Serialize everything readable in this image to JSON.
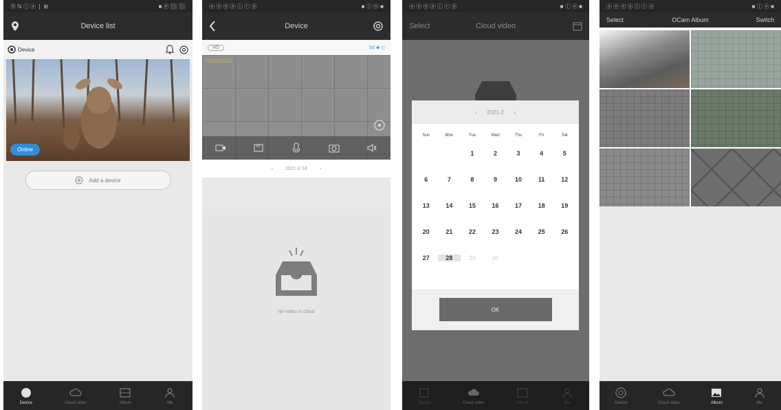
{
  "screen1": {
    "status_left": "Ⓢ ℕ ⓘ ⓐ ❘ ⊞",
    "status_right": "■ ⓟ ⬛ ⬛",
    "title": "Device list",
    "device_name": "Device",
    "online_label": "Online",
    "add_device_label": "Add a device",
    "tabs": [
      "Device",
      "Cloud video",
      "Album",
      "Me"
    ]
  },
  "screen2": {
    "status_left": "ⓐ ⓝ ⓔ ⓐ ⓘ ⓡ ⓐ",
    "status_right": "■ ⓘ ⓝ ■",
    "title": "Device",
    "quality_label": "HD",
    "signal_label": "5d ◆ ◻",
    "osd_timestamp": "▯▯▯▯▯▯▯▯",
    "date_label": "2021-2-18",
    "empty_text": "No video in cloud"
  },
  "screen3": {
    "status_left": "ⓐ ⓝ ⓔ ⓐ ⓘ ⓡ ⓐ",
    "status_right": "■ ⓘ ⓝ ■",
    "nav_left": "Select",
    "title": "Cloud video",
    "calendar_title": "2021-2",
    "weekdays": [
      "Sun",
      "Mon",
      "Tue",
      "Wed",
      "Thu",
      "Fri",
      "Sat"
    ],
    "days": [
      "",
      "",
      "1",
      "2",
      "3",
      "4",
      "5",
      "6",
      "7",
      "8",
      "9",
      "10",
      "11",
      "12",
      "13",
      "14",
      "15",
      "16",
      "17",
      "18",
      "19",
      "20",
      "21",
      "22",
      "23",
      "24",
      "25",
      "26",
      "27",
      "28",
      "29",
      "30"
    ],
    "selected_day": "28",
    "ok_label": "OK",
    "tabs": [
      "Device",
      "Cloud video",
      "Album",
      "Me"
    ]
  },
  "screen4": {
    "status_left": "ⓐ ⓝ ⓔ ⓐ ⓘ ⓡ ⓐ",
    "status_right": "■ ⓘ ⓝ ■",
    "nav_left": "Select",
    "title": "OCam Album",
    "nav_right": "Switch",
    "tabs": [
      "Device",
      "Cloud video",
      "Album",
      "Me"
    ]
  }
}
